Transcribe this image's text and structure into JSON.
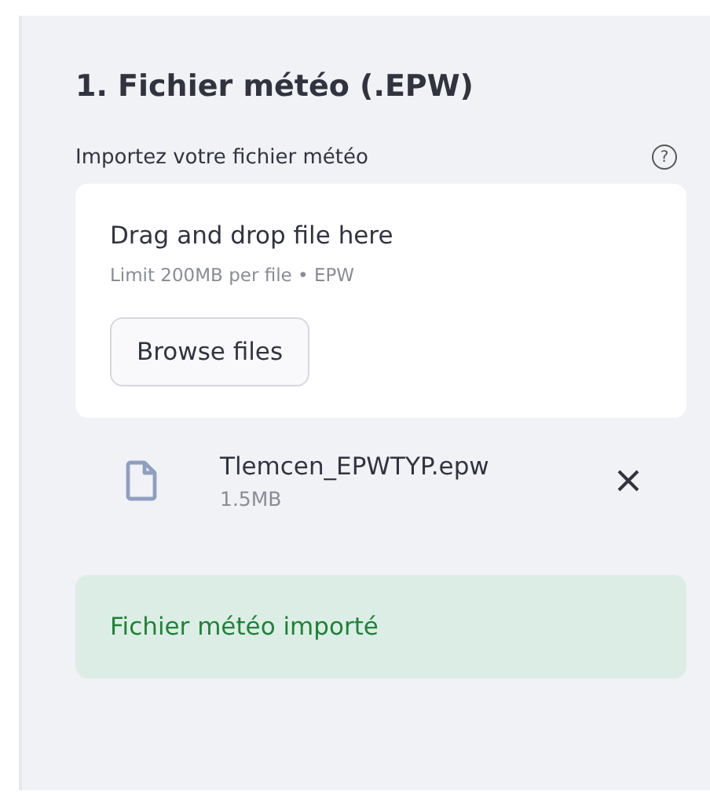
{
  "section": {
    "title": "1. Fichier météo (.EPW)"
  },
  "uploader": {
    "label": "Importez votre fichier météo",
    "help": "?",
    "dropzone_title": "Drag and drop file here",
    "dropzone_hint": "Limit 200MB per file • EPW",
    "button": "Browse files"
  },
  "files": [
    {
      "name": "Tlemcen_EPWTYP.epw",
      "size": "1.5MB"
    }
  ],
  "alert": {
    "kind": "success",
    "text": "Fichier météo importé"
  }
}
